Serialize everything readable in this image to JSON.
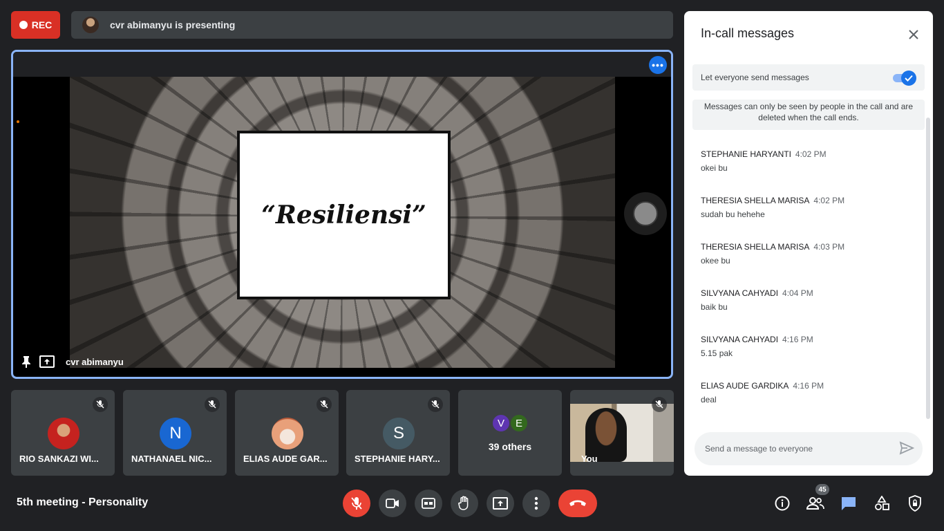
{
  "top": {
    "rec_label": "REC",
    "presenting_text": "cvr abimanyu is presenting"
  },
  "stage": {
    "slide_title": "“Resiliensi”",
    "presenter_name": "cvr abimanyu"
  },
  "tiles": [
    {
      "name": "RIO SANKAZI WI...",
      "avatar_color": "#c5221f"
    },
    {
      "name": "NATHANAEL NIC...",
      "initial": "N",
      "avatar_color": "#1967d2"
    },
    {
      "name": "ELIAS AUDE GAR...",
      "avatar_color": "#e8a07a"
    },
    {
      "name": "STEPHANIE HARY...",
      "initial": "S",
      "avatar_color": "#455a64"
    },
    {
      "others_label": "39 others",
      "initials": [
        "V",
        "E"
      ],
      "colors": [
        "#5e35b1",
        "#33691e"
      ]
    },
    {
      "name": "You"
    }
  ],
  "bottom": {
    "meeting_title": "5th meeting - Personality",
    "participants_count": "45"
  },
  "chat": {
    "title": "In-call messages",
    "toggle_label": "Let everyone send messages",
    "toggle_on": true,
    "notice": "Messages can only be seen by people in the call and are deleted when the call ends.",
    "messages": [
      {
        "sender": "STEPHANIE HARYANTI",
        "time": "4:02 PM",
        "text": "okei bu"
      },
      {
        "sender": "THERESIA SHELLA MARISA",
        "time": "4:02 PM",
        "text": "sudah bu hehehe"
      },
      {
        "sender": "THERESIA SHELLA MARISA",
        "time": "4:03 PM",
        "text": "okee bu"
      },
      {
        "sender": "SILVYANA CAHYADI",
        "time": "4:04 PM",
        "text": "baik bu"
      },
      {
        "sender": "SILVYANA CAHYADI",
        "time": "4:16 PM",
        "text": "5.15 pak"
      },
      {
        "sender": "ELIAS AUDE GARDIKA",
        "time": "4:16 PM",
        "text": "deal"
      }
    ],
    "input_placeholder": "Send a message to everyone"
  },
  "colors": {
    "background": "#202124",
    "tile": "#3c4043",
    "accent_blue": "#1a73e8",
    "danger_red": "#ea4335"
  }
}
